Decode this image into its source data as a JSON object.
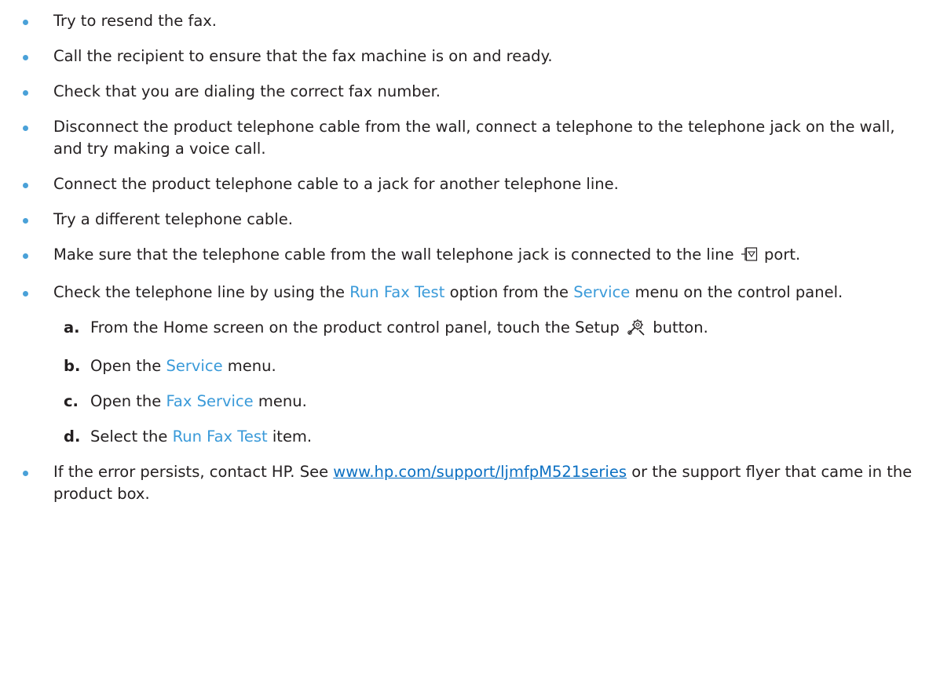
{
  "bullets": [
    {
      "text": "Try to resend the fax."
    },
    {
      "text": "Call the recipient to ensure that the fax machine is on and ready."
    },
    {
      "text": "Check that you are dialing the correct fax number."
    },
    {
      "text": "Disconnect the product telephone cable from the wall, connect a telephone to the telephone jack on the wall, and try making a voice call."
    },
    {
      "text": "Connect the product telephone cable to a jack for another telephone line."
    },
    {
      "text": "Try a different telephone cable."
    },
    {
      "before": "Make sure that the telephone cable from the wall telephone jack is connected to the line",
      "icon": "line-port-icon",
      "after": "port."
    },
    {
      "part1": "Check the telephone line by using the",
      "term1": "Run Fax Test",
      "part2": "option from the",
      "term2": "Service",
      "part3": "menu on the control panel.",
      "steps": [
        {
          "letter": "a.",
          "before": "From the Home screen on the product control panel, touch the Setup",
          "icon": "setup-icon",
          "after": "button."
        },
        {
          "letter": "b.",
          "before": "Open the",
          "term": "Service",
          "after": "menu."
        },
        {
          "letter": "c.",
          "before": "Open the",
          "term": "Fax Service",
          "after": "menu."
        },
        {
          "letter": "d.",
          "before": "Select the",
          "term": "Run Fax Test",
          "after": "item."
        }
      ]
    },
    {
      "before": "If the error persists, contact HP. See",
      "link": "www.hp.com/support/ljmfpM521series",
      "after": "or the support flyer that came in the product box."
    }
  ],
  "colors": {
    "bullet": "#4aa1d8",
    "menu_term": "#3a9ad9",
    "link": "#0a6fc2",
    "text": "#231f20"
  }
}
